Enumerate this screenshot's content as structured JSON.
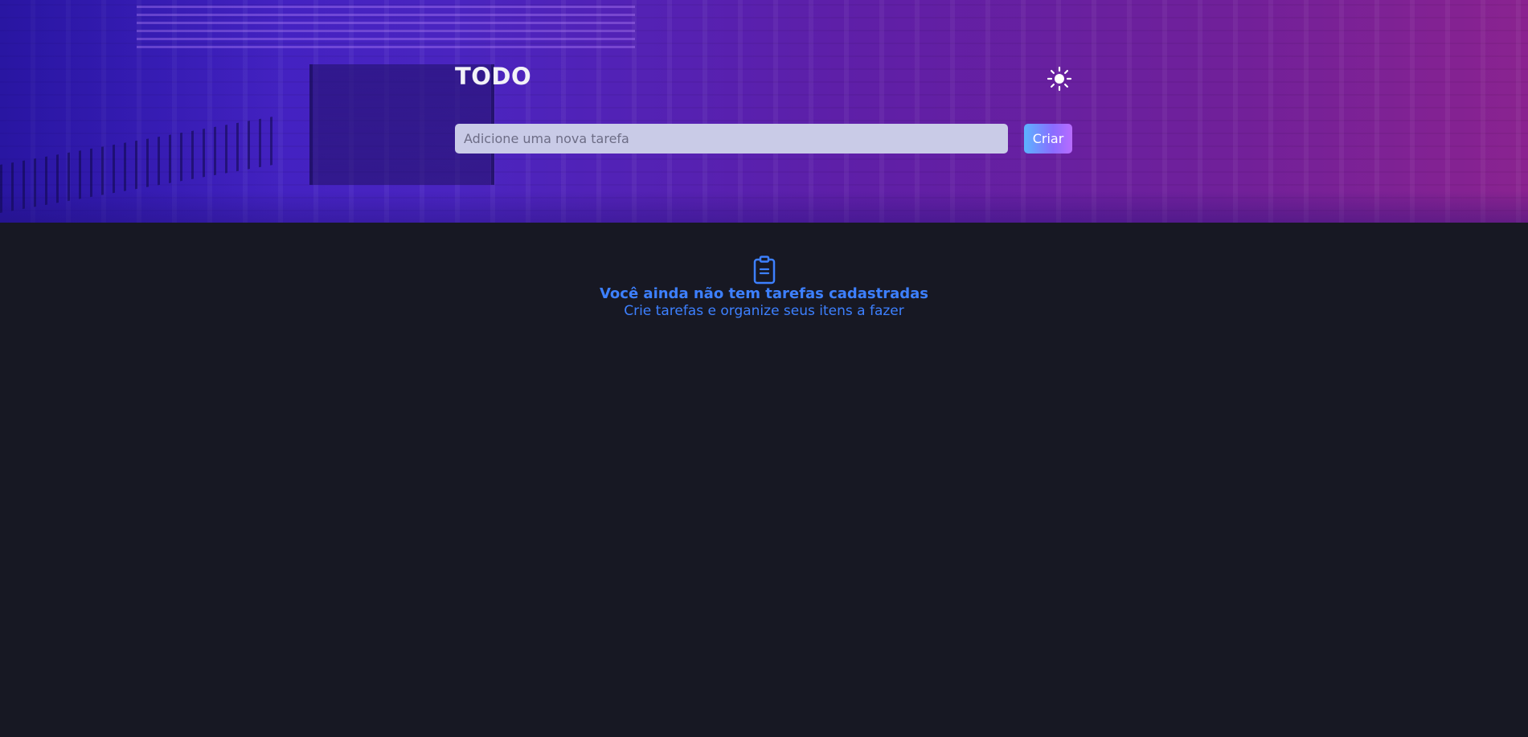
{
  "header": {
    "title": "TODO",
    "theme_icon": "sun-icon"
  },
  "new_task": {
    "placeholder": "Adicione uma nova tarefa",
    "value": "",
    "create_label": "Criar"
  },
  "empty_state": {
    "icon": "clipboard-icon",
    "title": "Você ainda não tem tarefas cadastradas",
    "subtitle": "Crie tarefas e organize seus itens a fazer"
  },
  "colors": {
    "background": "#171823",
    "accent": "#3d80ff",
    "input_background": "#c9cbe7"
  }
}
